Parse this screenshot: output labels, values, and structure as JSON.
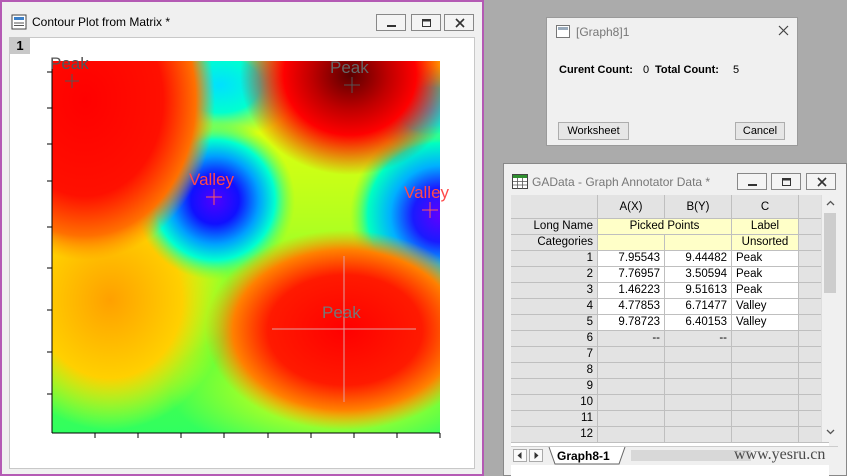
{
  "graph_window": {
    "title": "Contour Plot from Matrix *",
    "layer_label": "1",
    "annotations": [
      {
        "label": "Peak",
        "kind": "peak"
      },
      {
        "label": "Peak",
        "kind": "peak"
      },
      {
        "label": "Valley",
        "kind": "valley"
      },
      {
        "label": "Valley",
        "kind": "valley"
      },
      {
        "label": "Peak",
        "kind": "peak"
      }
    ],
    "colors": {
      "peak_label": "#ff5a5a",
      "valley_label": "#ff5050",
      "frame_border": "#b45ab4"
    }
  },
  "dialog": {
    "title": "[Graph8]1",
    "current_count_label": "Curent Count:",
    "current_count_value": "0",
    "total_count_label": "Total Count:",
    "total_count_value": "5",
    "worksheet_button": "Worksheet",
    "cancel_button": "Cancel"
  },
  "worksheet": {
    "title": "GAData - Graph Annotator Data *",
    "columns": [
      "A(X)",
      "B(Y)",
      "C"
    ],
    "long_name_label": "Long Name",
    "categories_label": "Categories",
    "long_name_ab": "Picked Points",
    "long_name_c": "Label",
    "categories_c": "Unsorted",
    "rows": [
      {
        "n": "1",
        "x": "7.95543",
        "y": "9.44482",
        "label": "Peak"
      },
      {
        "n": "2",
        "x": "7.76957",
        "y": "3.50594",
        "label": "Peak"
      },
      {
        "n": "3",
        "x": "1.46223",
        "y": "9.51613",
        "label": "Peak"
      },
      {
        "n": "4",
        "x": "4.77853",
        "y": "6.71477",
        "label": "Valley"
      },
      {
        "n": "5",
        "x": "9.78723",
        "y": "6.40153",
        "label": "Valley"
      },
      {
        "n": "6",
        "x": "--",
        "y": "--",
        "label": ""
      },
      {
        "n": "7",
        "x": "",
        "y": "",
        "label": ""
      },
      {
        "n": "8",
        "x": "",
        "y": "",
        "label": ""
      },
      {
        "n": "9",
        "x": "",
        "y": "",
        "label": ""
      },
      {
        "n": "10",
        "x": "",
        "y": "",
        "label": ""
      },
      {
        "n": "11",
        "x": "",
        "y": "",
        "label": ""
      },
      {
        "n": "12",
        "x": "",
        "y": "",
        "label": ""
      }
    ],
    "sheet_tab": "Graph8-1"
  },
  "watermark": "www.yesru.cn"
}
